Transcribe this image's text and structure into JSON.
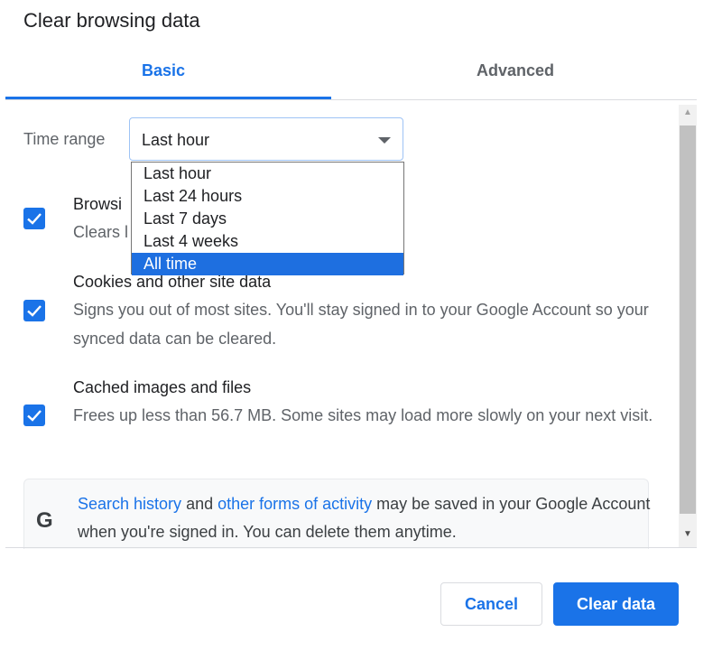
{
  "dialog": {
    "title": "Clear browsing data"
  },
  "tabs": [
    {
      "label": "Basic",
      "active": true
    },
    {
      "label": "Advanced",
      "active": false
    }
  ],
  "time_range": {
    "label": "Time range",
    "selected": "Last hour",
    "options": [
      "Last hour",
      "Last 24 hours",
      "Last 7 days",
      "Last 4 weeks",
      "All time"
    ],
    "highlighted": "All time"
  },
  "items": [
    {
      "title": "Browsing history",
      "title_visible": "Browsi",
      "description": "Clears history",
      "description_visible": "Clears l",
      "checked": true
    },
    {
      "title": "Cookies and other site data",
      "description": "Signs you out of most sites. You'll stay signed in to your Google Account so your synced data can be cleared.",
      "checked": true
    },
    {
      "title": "Cached images and files",
      "description": "Frees up less than 56.7 MB. Some sites may load more slowly on your next visit.",
      "checked": true
    }
  ],
  "info": {
    "icon": "google-g-icon",
    "link1": "Search history",
    "text1": " and ",
    "link2": "other forms of activity",
    "text2": " may be saved in your Google Account when you're signed in. You can delete them anytime."
  },
  "buttons": {
    "cancel": "Cancel",
    "clear": "Clear data"
  },
  "colors": {
    "accent": "#1a73e8",
    "highlight": "#1e6fe0"
  }
}
